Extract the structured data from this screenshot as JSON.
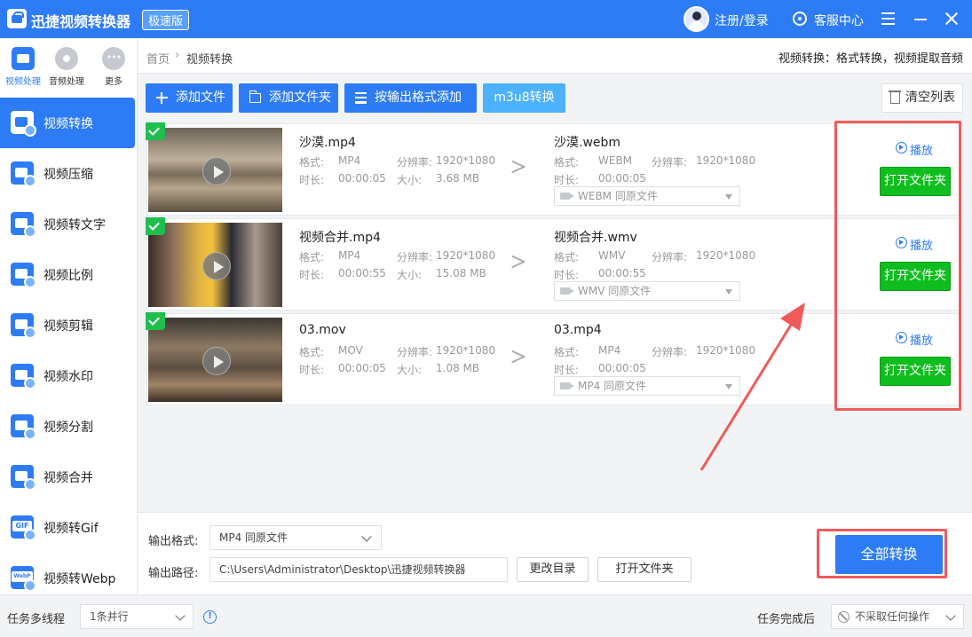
{
  "app": {
    "title": "迅捷视频转换器",
    "edition": "极速版",
    "login": "注册/登录",
    "service": "客服中心"
  },
  "sidebar": {
    "categories": [
      {
        "label": "视频处理",
        "icon": "video-process-icon",
        "active": true
      },
      {
        "label": "音频处理",
        "icon": "audio-process-icon",
        "active": false
      },
      {
        "label": "更多",
        "icon": "more-icon",
        "active": false
      }
    ],
    "items": [
      {
        "label": "视频转换",
        "icon": "video-convert-icon",
        "active": true
      },
      {
        "label": "视频压缩",
        "icon": "video-compress-icon",
        "active": false
      },
      {
        "label": "视频转文字",
        "icon": "video-to-text-icon",
        "active": false
      },
      {
        "label": "视频比例",
        "icon": "video-ratio-icon",
        "active": false
      },
      {
        "label": "视频剪辑",
        "icon": "video-edit-icon",
        "active": false
      },
      {
        "label": "视频水印",
        "icon": "video-watermark-icon",
        "active": false
      },
      {
        "label": "视频分割",
        "icon": "video-split-icon",
        "active": false
      },
      {
        "label": "视频合并",
        "icon": "video-merge-icon",
        "active": false
      },
      {
        "label": "视频转Gif",
        "icon": "video-to-gif-icon",
        "active": false
      },
      {
        "label": "视频转Webp",
        "icon": "video-to-webp-icon",
        "active": false
      }
    ]
  },
  "breadcrumb": {
    "home": "首页",
    "sep": "›",
    "current": "视频转换"
  },
  "feature_desc": "视频转换：格式转换，视频提取音频",
  "toolbar": {
    "add_file": "添加文件",
    "add_folder": "添加文件夹",
    "add_by_format": "按输出格式添加",
    "m3u8": "m3u8转换",
    "clear_list": "清空列表"
  },
  "labels": {
    "format": "格式:",
    "duration": "时长:",
    "resolution": "分辨率:",
    "size": "大小:",
    "play": "播放",
    "open_folder": "打开文件夹"
  },
  "files": [
    {
      "name": "沙漠.mp4",
      "format": "MP4",
      "duration": "00:00:05",
      "resolution": "1920*1080",
      "size": "3.68 MB",
      "out_name": "沙漠.webm",
      "out_format": "WEBM",
      "out_duration": "00:00:05",
      "out_resolution": "1920*1080",
      "out_select": "WEBM  同原文件",
      "checked": true
    },
    {
      "name": "视频合并.mp4",
      "format": "MP4",
      "duration": "00:00:55",
      "resolution": "1920*1080",
      "size": "15.08 MB",
      "out_name": "视频合并.wmv",
      "out_format": "WMV",
      "out_duration": "00:00:55",
      "out_resolution": "1920*1080",
      "out_select": "WMV  同原文件",
      "checked": true
    },
    {
      "name": "03.mov",
      "format": "MOV",
      "duration": "00:00:05",
      "resolution": "1920*1080",
      "size": "1.08 MB",
      "out_name": "03.mp4",
      "out_format": "MP4",
      "out_duration": "00:00:05",
      "out_resolution": "1920*1080",
      "out_select": "MP4  同原文件",
      "checked": true
    }
  ],
  "settings": {
    "output_format_label": "输出格式:",
    "output_format_value": "MP4  同原文件",
    "output_path_label": "输出路径:",
    "output_path_value": "C:\\Users\\Administrator\\Desktop\\迅捷视频转换器",
    "change_dir": "更改目录",
    "open_folder": "打开文件夹",
    "convert_all": "全部转换"
  },
  "statusbar": {
    "multithread_label": "任务多线程",
    "multithread_value": "1条并行",
    "after_label": "任务完成后",
    "after_value": "不采取任何操作"
  },
  "colors": {
    "primary": "#2d7cf6",
    "success": "#0fbe1e",
    "annotation": "#ef5b5b"
  }
}
